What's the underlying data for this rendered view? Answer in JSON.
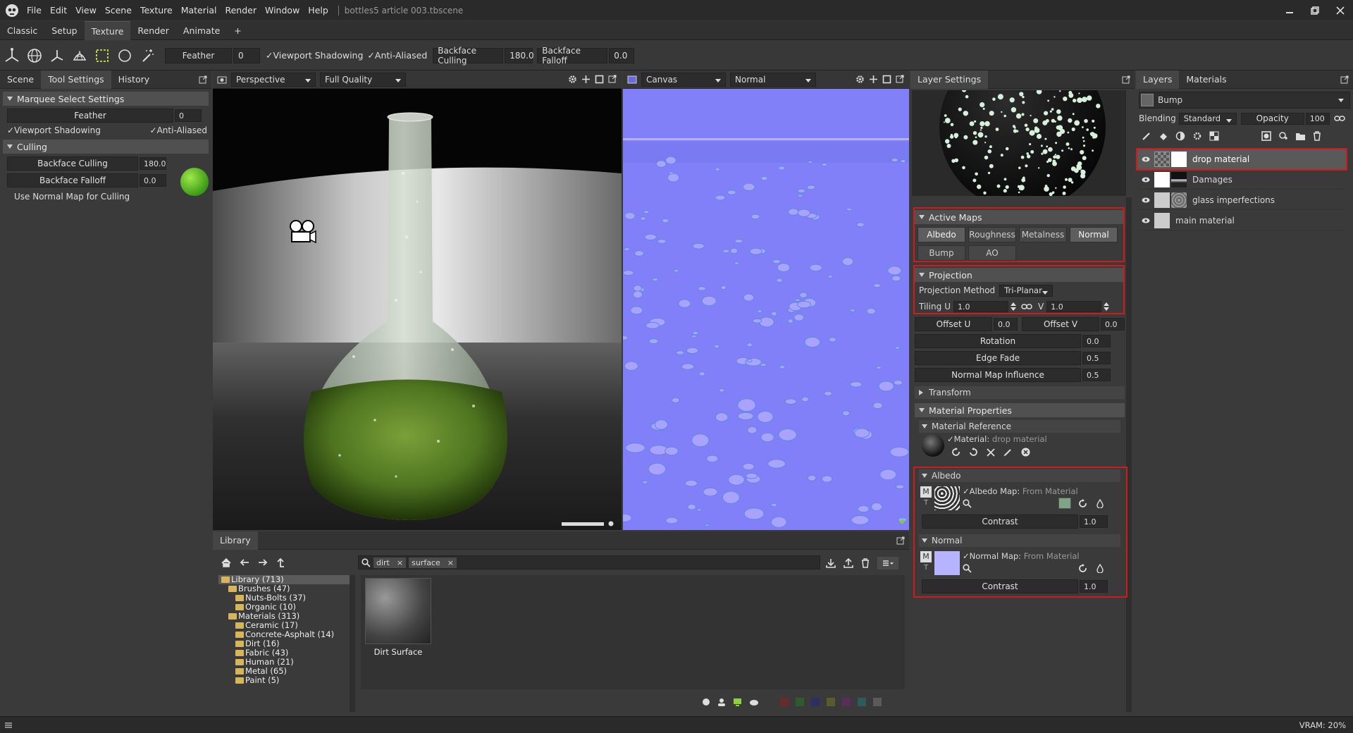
{
  "menubar": {
    "items": [
      "File",
      "Edit",
      "View",
      "Scene",
      "Texture",
      "Material",
      "Render",
      "Window",
      "Help"
    ],
    "document": "bottles5 article 003.tbscene"
  },
  "rooms": {
    "tabs": [
      "Classic",
      "Setup",
      "Texture",
      "Render",
      "Animate",
      "+"
    ],
    "active": "Texture"
  },
  "toolbar": {
    "feather_label": "Feather",
    "feather_value": "0",
    "viewport_shadowing": "Viewport Shadowing",
    "anti_aliased": "Anti-Aliased",
    "backface_culling": "Backface Culling",
    "backface_culling_value": "180.0",
    "backface_falloff": "Backface Falloff",
    "backface_falloff_value": "0.0"
  },
  "left_panel": {
    "tabs": [
      "Scene",
      "Tool Settings",
      "History"
    ],
    "marquee_header": "Marquee Select Settings",
    "feather_label": "Feather",
    "feather_value": "0",
    "viewport_shadowing": "Viewport Shadowing",
    "anti_aliased": "Anti-Aliased",
    "culling_header": "Culling",
    "backface_culling": "Backface Culling",
    "backface_culling_value": "180.0",
    "backface_falloff": "Backface Falloff",
    "backface_falloff_value": "0.0",
    "use_normal_map": "Use Normal Map for Culling"
  },
  "viewport": {
    "camera": "Perspective",
    "quality": "Full Quality"
  },
  "uvview": {
    "mode": "Canvas",
    "channel": "Normal"
  },
  "library": {
    "title": "Library",
    "tags": [
      "dirt",
      "surface"
    ],
    "tree": [
      {
        "label": "Library (713)",
        "level": 0,
        "selected": true
      },
      {
        "label": "Brushes (47)",
        "level": 1
      },
      {
        "label": "Nuts-Bolts (37)",
        "level": 2
      },
      {
        "label": "Organic (10)",
        "level": 2
      },
      {
        "label": "Materials (313)",
        "level": 1
      },
      {
        "label": "Ceramic (17)",
        "level": 2
      },
      {
        "label": "Concrete-Asphalt (14)",
        "level": 2
      },
      {
        "label": "Dirt (16)",
        "level": 2
      },
      {
        "label": "Fabric (43)",
        "level": 2
      },
      {
        "label": "Human (21)",
        "level": 2
      },
      {
        "label": "Metal (65)",
        "level": 2
      },
      {
        "label": "Paint (5)",
        "level": 2
      }
    ],
    "item_name": "Dirt Surface"
  },
  "layer_settings": {
    "title": "Layer Settings",
    "active_maps_header": "Active Maps",
    "maps": [
      "Albedo",
      "Roughness",
      "Metalness",
      "Normal",
      "Bump",
      "AO"
    ],
    "projection_header": "Projection",
    "projection_method_label": "Projection Method",
    "projection_method": "Tri-Planar",
    "tiling_label": "Tiling",
    "u_label": "U",
    "u_value": "1.0",
    "v_label": "V",
    "v_value": "1.0",
    "offset_u_label": "Offset U",
    "offset_u_value": "0.0",
    "offset_v_label": "Offset V",
    "offset_v_value": "0.0",
    "rotation_label": "Rotation",
    "rotation_value": "0.0",
    "edge_fade_label": "Edge Fade",
    "edge_fade_value": "0.5",
    "nm_influence_label": "Normal Map Influence",
    "nm_influence_value": "0.5",
    "transform_header": "Transform",
    "material_props_header": "Material Properties",
    "material_ref_header": "Material Reference",
    "material_label": "Material:",
    "material_value": "drop material",
    "albedo_header": "Albedo",
    "albedo_map_label": "Albedo Map:",
    "albedo_map_value": "From Material",
    "contrast_label": "Contrast",
    "albedo_contrast": "1.0",
    "normal_header": "Normal",
    "normal_map_label": "Normal Map:",
    "normal_map_value": "From Material",
    "normal_contrast": "1.0",
    "m_label": "M",
    "t_label": "T"
  },
  "layers_panel": {
    "tabs": [
      "Layers",
      "Materials"
    ],
    "channel": "Bump",
    "blending_label": "Blending",
    "blending": "Standard",
    "opacity_label": "Opacity",
    "opacity": "100",
    "layers": [
      "drop material",
      "Damages",
      "glass imperfections",
      "main material"
    ]
  },
  "statusbar": {
    "vram": "VRAM: 20%"
  },
  "colors": {
    "accent_red": "#d21a1a",
    "normal_map": "#8080ff"
  }
}
